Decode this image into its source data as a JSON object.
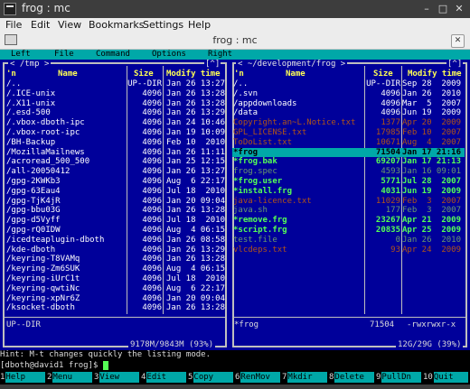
{
  "window": {
    "title": "frog : mc",
    "controls": {
      "minimize": "–",
      "maximize": "□",
      "close": "✕"
    }
  },
  "menubar": {
    "items": [
      "File",
      "Edit",
      "View",
      "Bookmarks",
      "Settings",
      "Help"
    ]
  },
  "toolbar": {
    "tab_title": "frog : mc",
    "close_icon": "✕"
  },
  "mc_menu": {
    "items": [
      "Left",
      "File",
      "Command",
      "Options",
      "Right"
    ]
  },
  "colors": {
    "panel_bg": "#00009a",
    "frame": "#bfbfbf",
    "header": "#ffff55",
    "dir": "#ffffff",
    "exec": "#55ff55",
    "file": "#dcdcdc",
    "backup": "#b05418",
    "cursor_bg": "#00a8a8",
    "cursor_fg": "#000000",
    "status_cyan": "#00a8a8"
  },
  "left_panel": {
    "path": "/tmp",
    "corner": "[^]",
    "headers": {
      "n": "'n",
      "name": "Name",
      "size": "Size",
      "mtime": "Modify time"
    },
    "files": [
      {
        "name": "/..",
        "size": "UP--DIR",
        "mtime": "Jan 26 13:27",
        "type": "dir"
      },
      {
        "name": "/.ICE-unix",
        "size": "4096",
        "mtime": "Jan 26 13:28",
        "type": "dir"
      },
      {
        "name": "/.X11-unix",
        "size": "4096",
        "mtime": "Jan 26 13:28",
        "type": "dir"
      },
      {
        "name": "/.esd-500",
        "size": "4096",
        "mtime": "Jan 26 13:29",
        "type": "dir"
      },
      {
        "name": "/.vbox-dboth-ipc",
        "size": "4096",
        "mtime": "Jan 24 10:46",
        "type": "dir"
      },
      {
        "name": "/.vbox-root-ipc",
        "size": "4096",
        "mtime": "Jan 19 10:09",
        "type": "dir"
      },
      {
        "name": "/BH-Backup",
        "size": "4096",
        "mtime": "Feb 10  2010",
        "type": "dir"
      },
      {
        "name": "/MozillaMailnews",
        "size": "4096",
        "mtime": "Jan 26 11:11",
        "type": "dir"
      },
      {
        "name": "/acroread_500_500",
        "size": "4096",
        "mtime": "Jan 25 12:15",
        "type": "dir"
      },
      {
        "name": "/all-20050412",
        "size": "4096",
        "mtime": "Jan 26 13:27",
        "type": "dir"
      },
      {
        "name": "/gpg-2KWKb3",
        "size": "4096",
        "mtime": "Aug  6 22:17",
        "type": "dir"
      },
      {
        "name": "/gpg-63Eau4",
        "size": "4096",
        "mtime": "Jul 18  2010",
        "type": "dir"
      },
      {
        "name": "/gpg-TjK4jR",
        "size": "4096",
        "mtime": "Jan 20 09:04",
        "type": "dir"
      },
      {
        "name": "/gpg-bbu03G",
        "size": "4096",
        "mtime": "Jan 26 13:28",
        "type": "dir"
      },
      {
        "name": "/gpg-d5Vyff",
        "size": "4096",
        "mtime": "Jul 18  2010",
        "type": "dir"
      },
      {
        "name": "/gpg-rQ0IDW",
        "size": "4096",
        "mtime": "Aug  4 06:15",
        "type": "dir"
      },
      {
        "name": "/icedteaplugin-dboth",
        "size": "4096",
        "mtime": "Jan 26 08:58",
        "type": "dir"
      },
      {
        "name": "/kde-dboth",
        "size": "4096",
        "mtime": "Jan 26 13:29",
        "type": "dir"
      },
      {
        "name": "/keyring-T8VAMq",
        "size": "4096",
        "mtime": "Jan 26 13:28",
        "type": "dir"
      },
      {
        "name": "/keyring-Zm6SUK",
        "size": "4096",
        "mtime": "Aug  4 06:15",
        "type": "dir"
      },
      {
        "name": "/keyring-iUrC1t",
        "size": "4096",
        "mtime": "Jul 18  2010",
        "type": "dir"
      },
      {
        "name": "/keyring-qwtiNc",
        "size": "4096",
        "mtime": "Aug  6 22:17",
        "type": "dir"
      },
      {
        "name": "/keyring-xpNr6Z",
        "size": "4096",
        "mtime": "Jan 20 09:04",
        "type": "dir"
      },
      {
        "name": "/ksocket-dboth",
        "size": "4096",
        "mtime": "Jan 26 13:28",
        "type": "dir"
      }
    ],
    "mini_status": "UP--DIR",
    "disk_status": "9178M/9843M (93%)"
  },
  "right_panel": {
    "path": "~/development/frog",
    "corner": "[^]",
    "headers": {
      "n": "'n",
      "name": "Name",
      "size": "Size",
      "mtime": "Modify time"
    },
    "files": [
      {
        "name": "/..",
        "size": "UP--DIR",
        "mtime": "Sep 28  2009",
        "type": "dir"
      },
      {
        "name": "/.svn",
        "size": "4096",
        "mtime": "Jan 26  2010",
        "type": "dir"
      },
      {
        "name": "/appdownloads",
        "size": "4096",
        "mtime": "Mar  5  2007",
        "type": "dir"
      },
      {
        "name": "/data",
        "size": "4096",
        "mtime": "Jun 19  2009",
        "type": "dir"
      },
      {
        "name": "Copyright.an~L.Notice.txt",
        "size": "1377",
        "mtime": "Apr 20  2009",
        "type": "backup"
      },
      {
        "name": "GPL_LICENSE.txt",
        "size": "17985",
        "mtime": "Feb 10  2007",
        "type": "backup"
      },
      {
        "name": "ToDoList.txt",
        "size": "10671",
        "mtime": "Aug  4  2007",
        "type": "backup"
      },
      {
        "name": "*frog",
        "size": "71504",
        "mtime": "Jan 17 21:16",
        "type": "selected"
      },
      {
        "name": "*frog.bak",
        "size": "69207",
        "mtime": "Jan 17 21:13",
        "type": "exec"
      },
      {
        "name": "frog.spec",
        "size": "4593",
        "mtime": "Jan 16 09:01",
        "type": "dim"
      },
      {
        "name": "*frog.user",
        "size": "5771",
        "mtime": "Jul 28  2007",
        "type": "exec"
      },
      {
        "name": "*install.frg",
        "size": "4031",
        "mtime": "Jun 19  2009",
        "type": "exec"
      },
      {
        "name": "java-licence.txt",
        "size": "11029",
        "mtime": "Feb  3  2007",
        "type": "backup"
      },
      {
        "name": "java.sh",
        "size": "177",
        "mtime": "Feb  3  2007",
        "type": "dim"
      },
      {
        "name": "*remove.frg",
        "size": "23267",
        "mtime": "Apr 21  2009",
        "type": "exec"
      },
      {
        "name": "*script.frg",
        "size": "20835",
        "mtime": "Apr 25  2009",
        "type": "exec"
      },
      {
        "name": "test.file",
        "size": "0",
        "mtime": "Jan 26  2010",
        "type": "dim"
      },
      {
        "name": "vlcdeps.txt",
        "size": "93",
        "mtime": "Apr 24  2009",
        "type": "backup"
      }
    ],
    "mini_name": "*frog",
    "mini_size": "71504",
    "mini_perm": "-rwxrwxr-x",
    "disk_status": "12G/29G (39%)"
  },
  "hint": "Hint: M-t changes quickly the listing mode.",
  "prompt": "[dboth@david1 frog]$ ",
  "fkeys": [
    {
      "num": "1",
      "label": "Help"
    },
    {
      "num": "2",
      "label": "Menu"
    },
    {
      "num": "3",
      "label": "View"
    },
    {
      "num": "4",
      "label": "Edit"
    },
    {
      "num": "5",
      "label": "Copy"
    },
    {
      "num": "6",
      "label": "RenMov"
    },
    {
      "num": "7",
      "label": "Mkdir"
    },
    {
      "num": "8",
      "label": "Delete"
    },
    {
      "num": "9",
      "label": "PullDn"
    },
    {
      "num": "10",
      "label": "Quit"
    }
  ]
}
